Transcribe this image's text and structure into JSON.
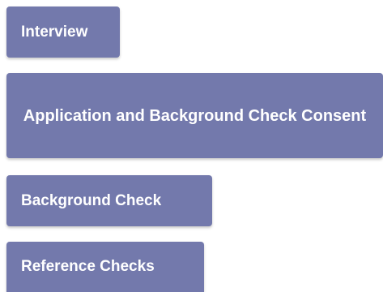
{
  "steps": [
    {
      "label": "Interview"
    },
    {
      "label": "Application and Background Check Consent"
    },
    {
      "label": "Background Check"
    },
    {
      "label": "Reference Checks"
    }
  ],
  "colors": {
    "button_background": "#7379ac",
    "button_text": "#ffffff",
    "page_background": "#ffffff"
  }
}
